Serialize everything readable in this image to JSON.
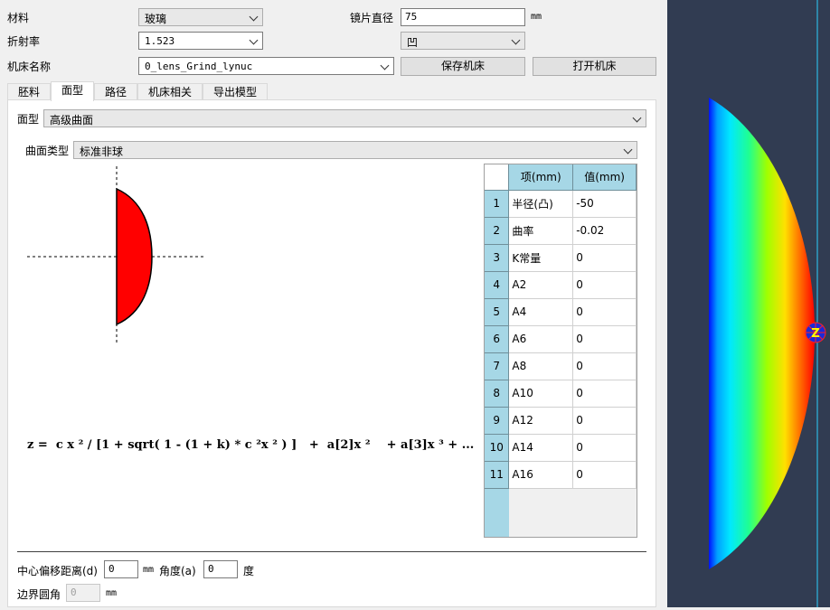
{
  "top": {
    "material_label": "材料",
    "material_value": "玻璃",
    "diameter_label": "镜片直径",
    "diameter_value": "75",
    "diameter_unit": "mm",
    "refraction_label": "折射率",
    "refraction_value": "1.523",
    "shape_value": "凹",
    "machine_label": "机床名称",
    "machine_value": "0_lens_Grind_lynuc",
    "save_machine": "保存机床",
    "open_machine": "打开机床"
  },
  "tabs": [
    "胚料",
    "面型",
    "路径",
    "机床相关",
    "导出模型"
  ],
  "active_tab": 1,
  "surface": {
    "type_label": "面型",
    "type_value": "高级曲面",
    "curve_label": "曲面类型",
    "curve_value": "标准非球"
  },
  "formula": "z =  c x ² / [1 + sqrt( 1 - (1 + k) * c ²x ² ) ]   +  a[2]x ²    + a[3]x ³ + ...",
  "grid": {
    "headers": [
      "项(mm)",
      "值(mm)"
    ],
    "rows": [
      {
        "n": "1",
        "item": "半径(凸)",
        "value": "-50"
      },
      {
        "n": "2",
        "item": "曲率",
        "value": "-0.02"
      },
      {
        "n": "3",
        "item": "K常量",
        "value": "0"
      },
      {
        "n": "4",
        "item": "A2",
        "value": "0"
      },
      {
        "n": "5",
        "item": "A4",
        "value": "0"
      },
      {
        "n": "6",
        "item": "A6",
        "value": "0"
      },
      {
        "n": "7",
        "item": "A8",
        "value": "0"
      },
      {
        "n": "8",
        "item": "A10",
        "value": "0"
      },
      {
        "n": "9",
        "item": "A12",
        "value": "0"
      },
      {
        "n": "10",
        "item": "A14",
        "value": "0"
      },
      {
        "n": "11",
        "item": "A16",
        "value": "0"
      }
    ]
  },
  "bottom": {
    "offset_label": "中心偏移距离(d)",
    "offset_value": "0",
    "offset_unit": "mm",
    "angle_label": "角度(a)",
    "angle_value": "0",
    "angle_unit": "度",
    "fillet_label": "边界圆角",
    "fillet_value": "0",
    "fillet_unit": "mm"
  },
  "viewer": {
    "axis_label": "Z",
    "background": "#313c52"
  },
  "colors": {
    "lens_fill": "#ff0000",
    "grid_header": "#a6d7e6"
  }
}
